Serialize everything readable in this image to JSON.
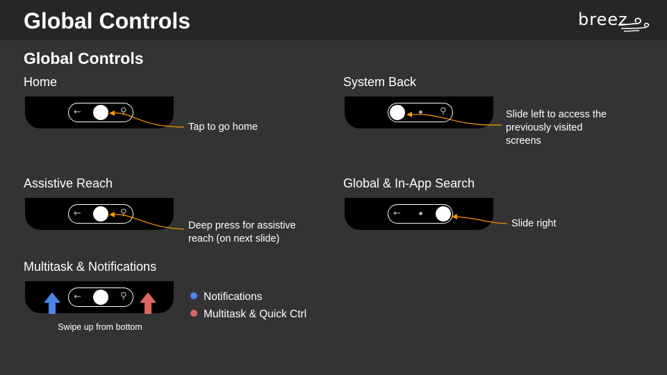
{
  "header": {
    "title": "Global Controls",
    "logo_text": "breez"
  },
  "section_title": "Global Controls",
  "panels": {
    "home": {
      "label": "Home",
      "note": "Tap to go home"
    },
    "system_back": {
      "label": "System Back",
      "note_lines": [
        "Slide left to access  the",
        "previously visited",
        "screens"
      ]
    },
    "assistive_reach": {
      "label": "Assistive Reach",
      "note_lines": [
        "Deep press for assistive",
        "reach (on next slide)"
      ]
    },
    "global_search": {
      "label": "Global & In-App Search",
      "note": "Slide right"
    },
    "multitask": {
      "label": "Multitask & Notifications",
      "caption": "Swipe up from bottom"
    }
  },
  "legend": [
    {
      "label": "Notifications",
      "color": "#4a86e8"
    },
    {
      "label": "Multitask & Quick Ctrl",
      "color": "#e06666"
    }
  ],
  "colors": {
    "accent": "#ff9900",
    "background": "#333333",
    "header": "#262626"
  },
  "icons": {
    "back": "arrow-left-icon",
    "search": "search-icon"
  }
}
